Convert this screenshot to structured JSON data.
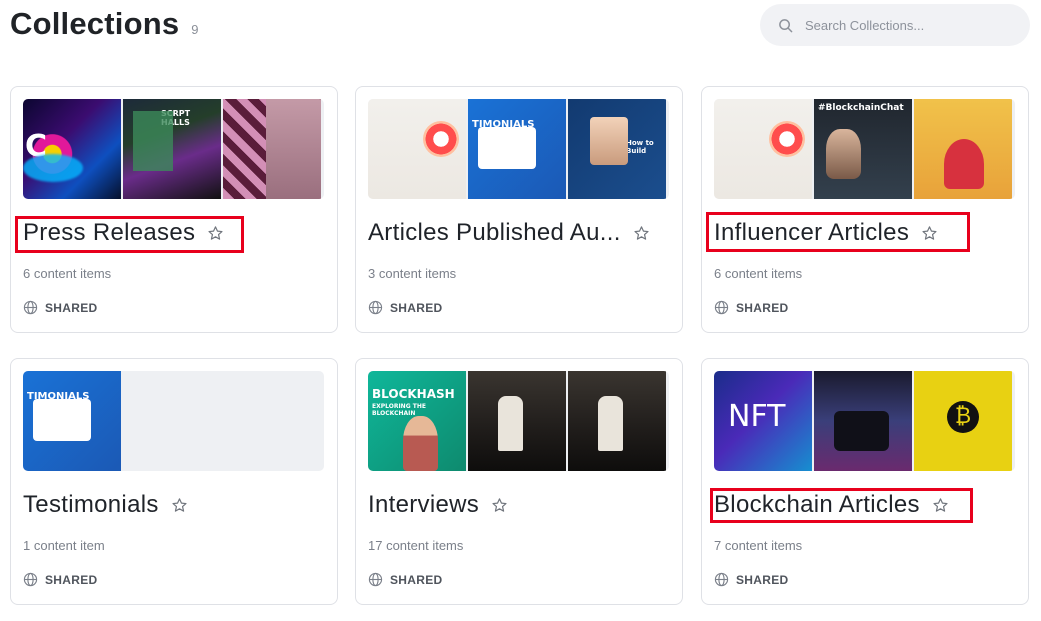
{
  "header": {
    "title": "Collections",
    "count": "9"
  },
  "search": {
    "placeholder": "Search Collections..."
  },
  "collections": [
    {
      "title": "Press Releases",
      "items": "6 content items",
      "shared": "SHARED",
      "thumbs": [
        "t-neon",
        "t-art",
        "t-pink"
      ],
      "highlighted": true
    },
    {
      "title": "Articles Published Au...",
      "items": "3 content items",
      "shared": "SHARED",
      "thumbs": [
        "t-tweet",
        "t-blue",
        "t-navy"
      ],
      "highlighted": false
    },
    {
      "title": "Influencer Articles",
      "items": "6 content items",
      "shared": "SHARED",
      "thumbs": [
        "t-tweet",
        "t-dark",
        "t-cartoon"
      ],
      "highlighted": true
    },
    {
      "title": "Testimonials",
      "items": "1 content item",
      "shared": "SHARED",
      "thumbs": [
        "t-blue"
      ],
      "highlighted": false
    },
    {
      "title": "Interviews",
      "items": "17 content items",
      "shared": "SHARED",
      "thumbs": [
        "t-green",
        "t-room",
        "t-room"
      ],
      "highlighted": false
    },
    {
      "title": "Blockchain Articles",
      "items": "7 content items",
      "shared": "SHARED",
      "thumbs": [
        "t-nft",
        "t-stage",
        "t-btc"
      ],
      "highlighted": true
    }
  ],
  "thumb_text": {
    "c1a": "C",
    "c1b": "SCRPT HALLS",
    "c2b": "TIMONIALS",
    "c2c": "How to Build",
    "c3b": "#BlockchainChat",
    "c5a": "BLOCKHASH",
    "c5a2": "EXPLORING THE BLOCKCHAIN",
    "c6a": "NFT"
  },
  "colors": {
    "highlight": "#e8001c",
    "border": "#dfe1e6",
    "search_bg": "#f1f2f5"
  },
  "icons": {
    "search": "search-icon",
    "star": "star-icon",
    "globe": "globe-icon"
  }
}
